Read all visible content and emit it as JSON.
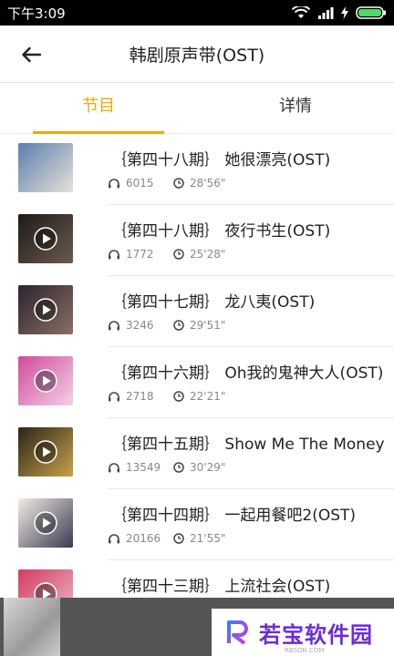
{
  "status_bar": {
    "time": "下午3:09"
  },
  "header": {
    "title": "韩剧原声带(OST)"
  },
  "tabs": [
    {
      "label": "节目"
    },
    {
      "label": "详情"
    }
  ],
  "episodes": [
    {
      "title": "｛第四十八期｝ 她很漂亮(OST)",
      "plays": "6015",
      "duration": "28'56\"",
      "colors": [
        "#5a7fb0",
        "#e7e0d8"
      ]
    },
    {
      "title": "｛第四十八期｝ 夜行书生(OST)",
      "plays": "1772",
      "duration": "25'28\"",
      "colors": [
        "#1f1a18",
        "#6a5a4e"
      ]
    },
    {
      "title": "｛第四十七期｝ 龙八夷(OST)",
      "plays": "3246",
      "duration": "29'51\"",
      "colors": [
        "#2c2430",
        "#8a6f63"
      ]
    },
    {
      "title": "｛第四十六期｝ Oh我的鬼神大人(OST)",
      "plays": "2718",
      "duration": "22'21\"",
      "colors": [
        "#d24a9a",
        "#f3d1e6"
      ]
    },
    {
      "title": "｛第四十五期｝ Show Me The Money",
      "plays": "13549",
      "duration": "30'29\"",
      "colors": [
        "#2b2418",
        "#c8a24a"
      ]
    },
    {
      "title": "｛第四十四期｝ 一起用餐吧2(OST)",
      "plays": "20166",
      "duration": "21'55\"",
      "colors": [
        "#f3ece4",
        "#3a3a52"
      ]
    },
    {
      "title": "｛第四十三期｝ 上流社会(OST)",
      "plays": "",
      "duration": "",
      "colors": [
        "#d43c5e",
        "#e9b8c6"
      ]
    }
  ],
  "watermark": {
    "text": "若宝软件园",
    "sub": "RBSON.COM"
  },
  "colors": {
    "accent": "#f0a800",
    "watermark": "#6b2cd6"
  }
}
